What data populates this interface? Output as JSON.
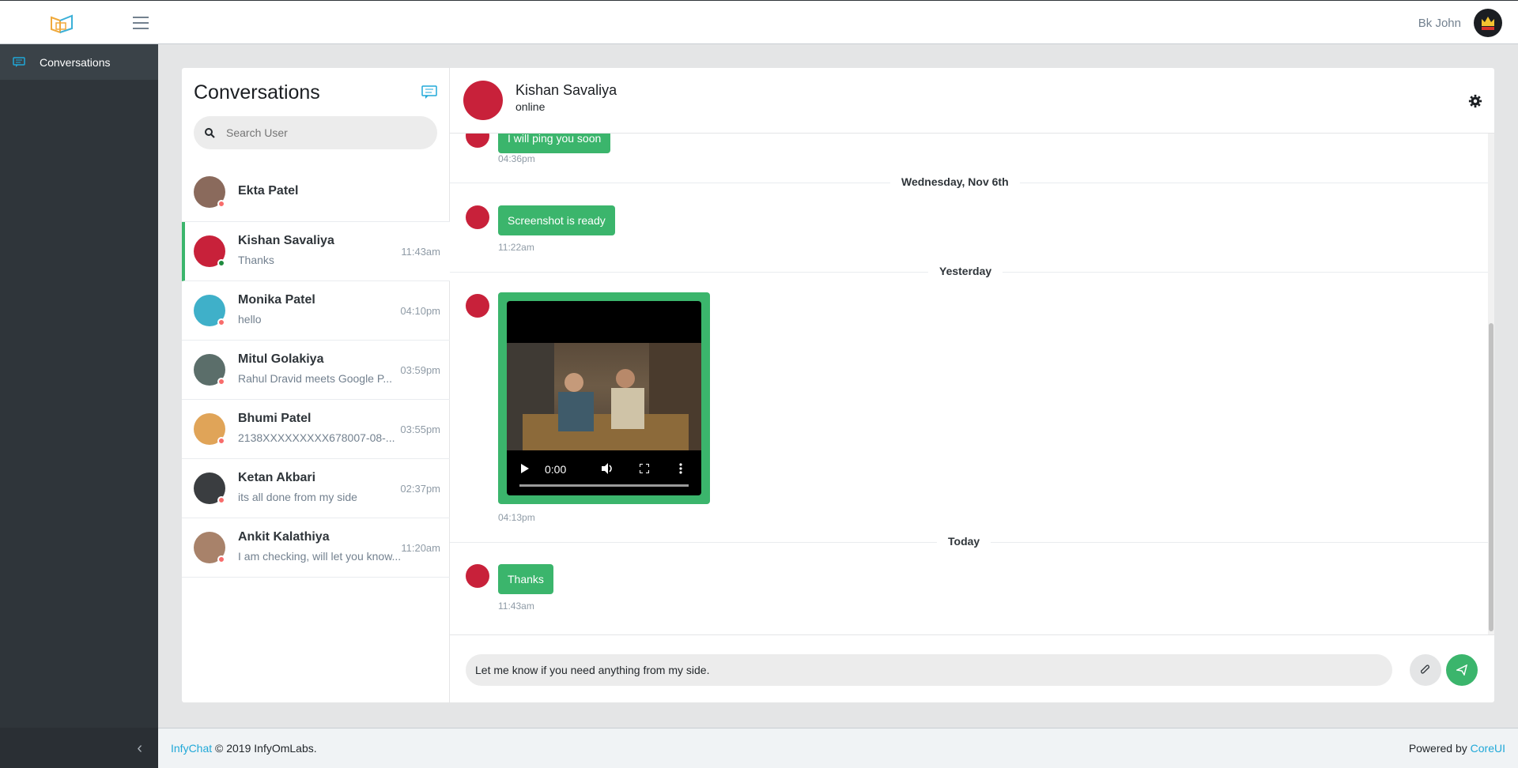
{
  "header": {
    "user_name": "Bk John"
  },
  "sidebar": {
    "items": [
      {
        "label": "Conversations"
      }
    ]
  },
  "conversations": {
    "title": "Conversations",
    "search_placeholder": "Search User",
    "contacts": [
      {
        "name": "Ekta Patel",
        "message": "",
        "time": "",
        "status": "offline",
        "avatar_color": "#8a6a5c"
      },
      {
        "name": "Kishan Savaliya",
        "message": "Thanks",
        "time": "11:43am",
        "status": "online",
        "avatar_color": "#c8213a",
        "active": true
      },
      {
        "name": "Monika Patel",
        "message": "hello",
        "time": "04:10pm",
        "status": "offline",
        "avatar_color": "#3fb0c9"
      },
      {
        "name": "Mitul Golakiya",
        "message": "Rahul Dravid meets Google P...",
        "time": "03:59pm",
        "status": "offline",
        "avatar_color": "#5b6e6a"
      },
      {
        "name": "Bhumi Patel",
        "message": "2138XXXXXXXXX678007-08-...",
        "time": "03:55pm",
        "status": "offline",
        "avatar_color": "#e0a458"
      },
      {
        "name": "Ketan Akbari",
        "message": "its all done from my side",
        "time": "02:37pm",
        "status": "offline",
        "avatar_color": "#3a3d40"
      },
      {
        "name": "Ankit Kalathiya",
        "message": "I am checking, will let you know...",
        "time": "11:20am",
        "status": "offline",
        "avatar_color": "#a8826a"
      }
    ]
  },
  "chat": {
    "name": "Kishan Savaliya",
    "status": "online",
    "messages": [
      {
        "text": "I will ping you soon",
        "time": "04:36pm"
      },
      {
        "date": "Wednesday, Nov 6th"
      },
      {
        "text": "Screenshot is ready",
        "time": "11:22am"
      },
      {
        "date": "Yesterday"
      },
      {
        "video_time": "0:00",
        "time": "04:13pm"
      },
      {
        "date": "Today"
      },
      {
        "text": "Thanks",
        "time": "11:43am"
      }
    ],
    "compose_value": "Let me know if you need anything from my side."
  },
  "footer": {
    "brand": "InfyChat",
    "copyright": "© 2019 InfyOmLabs.",
    "powered_by": "Powered by",
    "powered_link": "CoreUI"
  },
  "colors": {
    "accent": "#3bb56c",
    "sidebar": "#2f353a",
    "link": "#20a8d8",
    "offline_dot": "#f86c6b",
    "online_dot": "#1f8a3e"
  },
  "icons": [
    "app-logo-icon",
    "hamburger-icon",
    "chat-icon",
    "new-conversation-icon",
    "search-icon",
    "settings-gear-icon",
    "attachment-icon",
    "send-icon",
    "chevron-left-icon",
    "play-icon",
    "volume-icon",
    "fullscreen-icon",
    "more-icon"
  ]
}
